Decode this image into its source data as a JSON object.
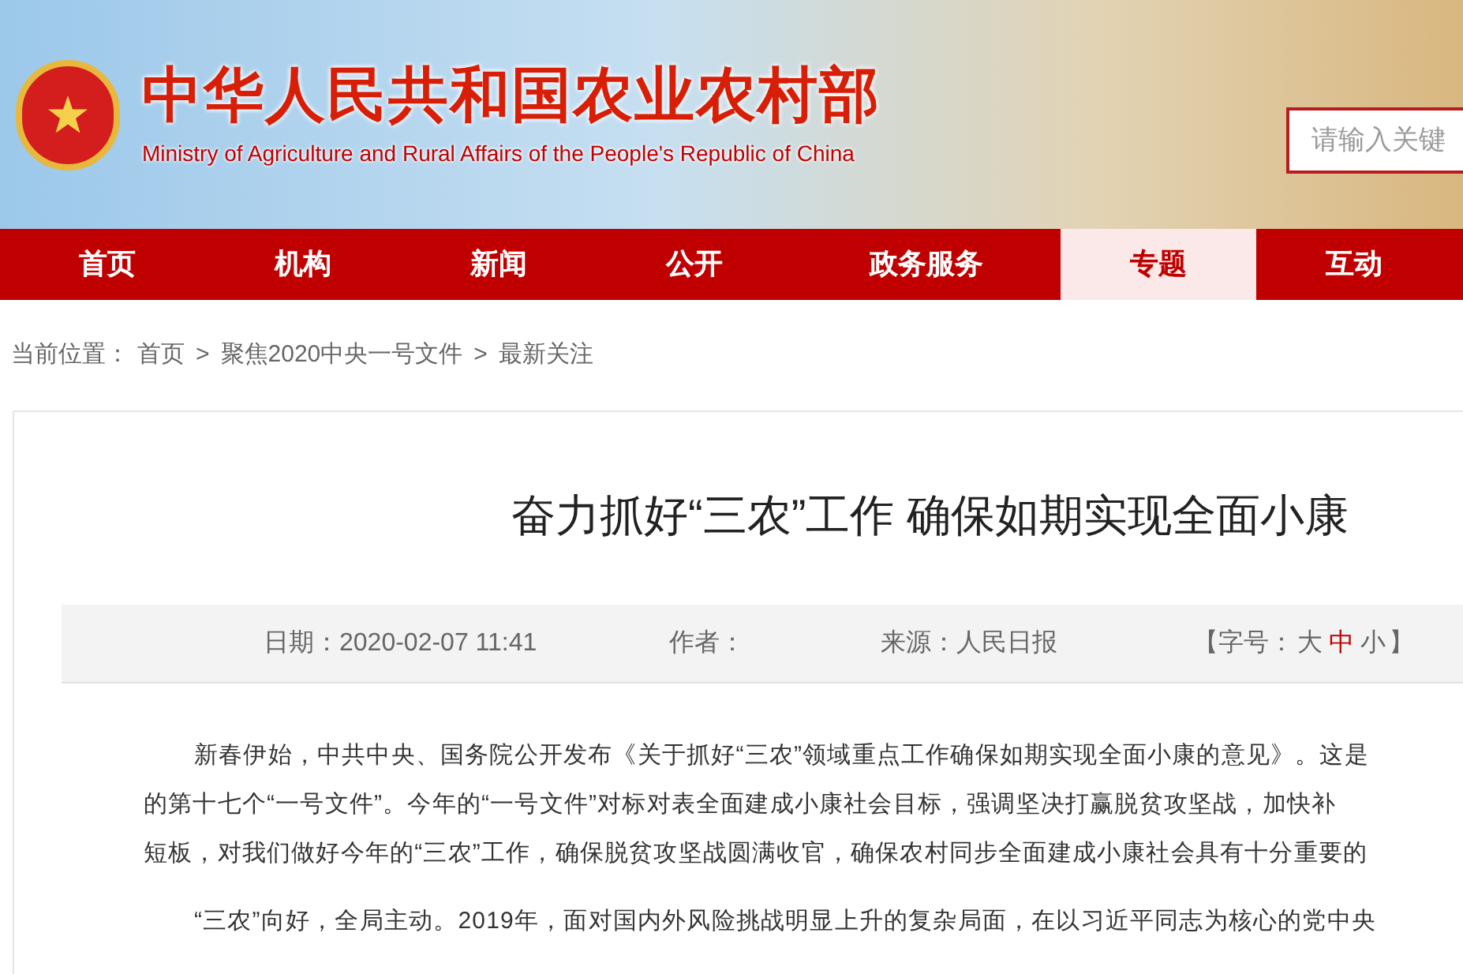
{
  "header": {
    "title": "中华人民共和国农业农村部",
    "subtitle": "Ministry of Agriculture and Rural Affairs of the People's Republic of China",
    "search": {
      "placeholder": "请输入关键"
    }
  },
  "nav": [
    {
      "label": "首页",
      "selected": false
    },
    {
      "label": "机构",
      "selected": false
    },
    {
      "label": "新闻",
      "selected": false
    },
    {
      "label": "公开",
      "selected": false
    },
    {
      "label": "政务服务",
      "selected": false
    },
    {
      "label": "专题",
      "selected": true
    },
    {
      "label": "互动",
      "selected": false
    }
  ],
  "breadcrumb": {
    "label": "当前位置：",
    "items": [
      "首页",
      "聚焦2020中央一号文件",
      "最新关注"
    ],
    "separator": ">"
  },
  "article": {
    "title": "奋力抓好“三农”工作 确保如期实现全面小康",
    "meta": {
      "date": "日期：2020-02-07 11:41",
      "author": "作者：",
      "source": "来源：人民日报",
      "font_size": {
        "open": "【字号：",
        "options": [
          {
            "label": "大",
            "selected": false
          },
          {
            "label": "中",
            "selected": true
          },
          {
            "label": "小",
            "selected": false
          }
        ],
        "close": "】"
      }
    },
    "paragraphs": [
      [
        "新春伊始，中共中央、国务院公开发布《关于抓好“三农”领域重点工作确保如期实现全面小康的意见》。这是",
        "的第十七个“一号文件”。今年的“一号文件”对标对表全面建成小康社会目标，强调坚决打赢脱贫攻坚战，加快补",
        "短板，对我们做好今年的“三农”工作，确保脱贫攻坚战圆满收官，确保农村同步全面建成小康社会具有十分重要的"
      ],
      [
        "“三农”向好，全局主动。2019年，面对国内外风险挑战明显上升的复杂局面，在以习近平同志为核心的党中央"
      ]
    ]
  }
}
